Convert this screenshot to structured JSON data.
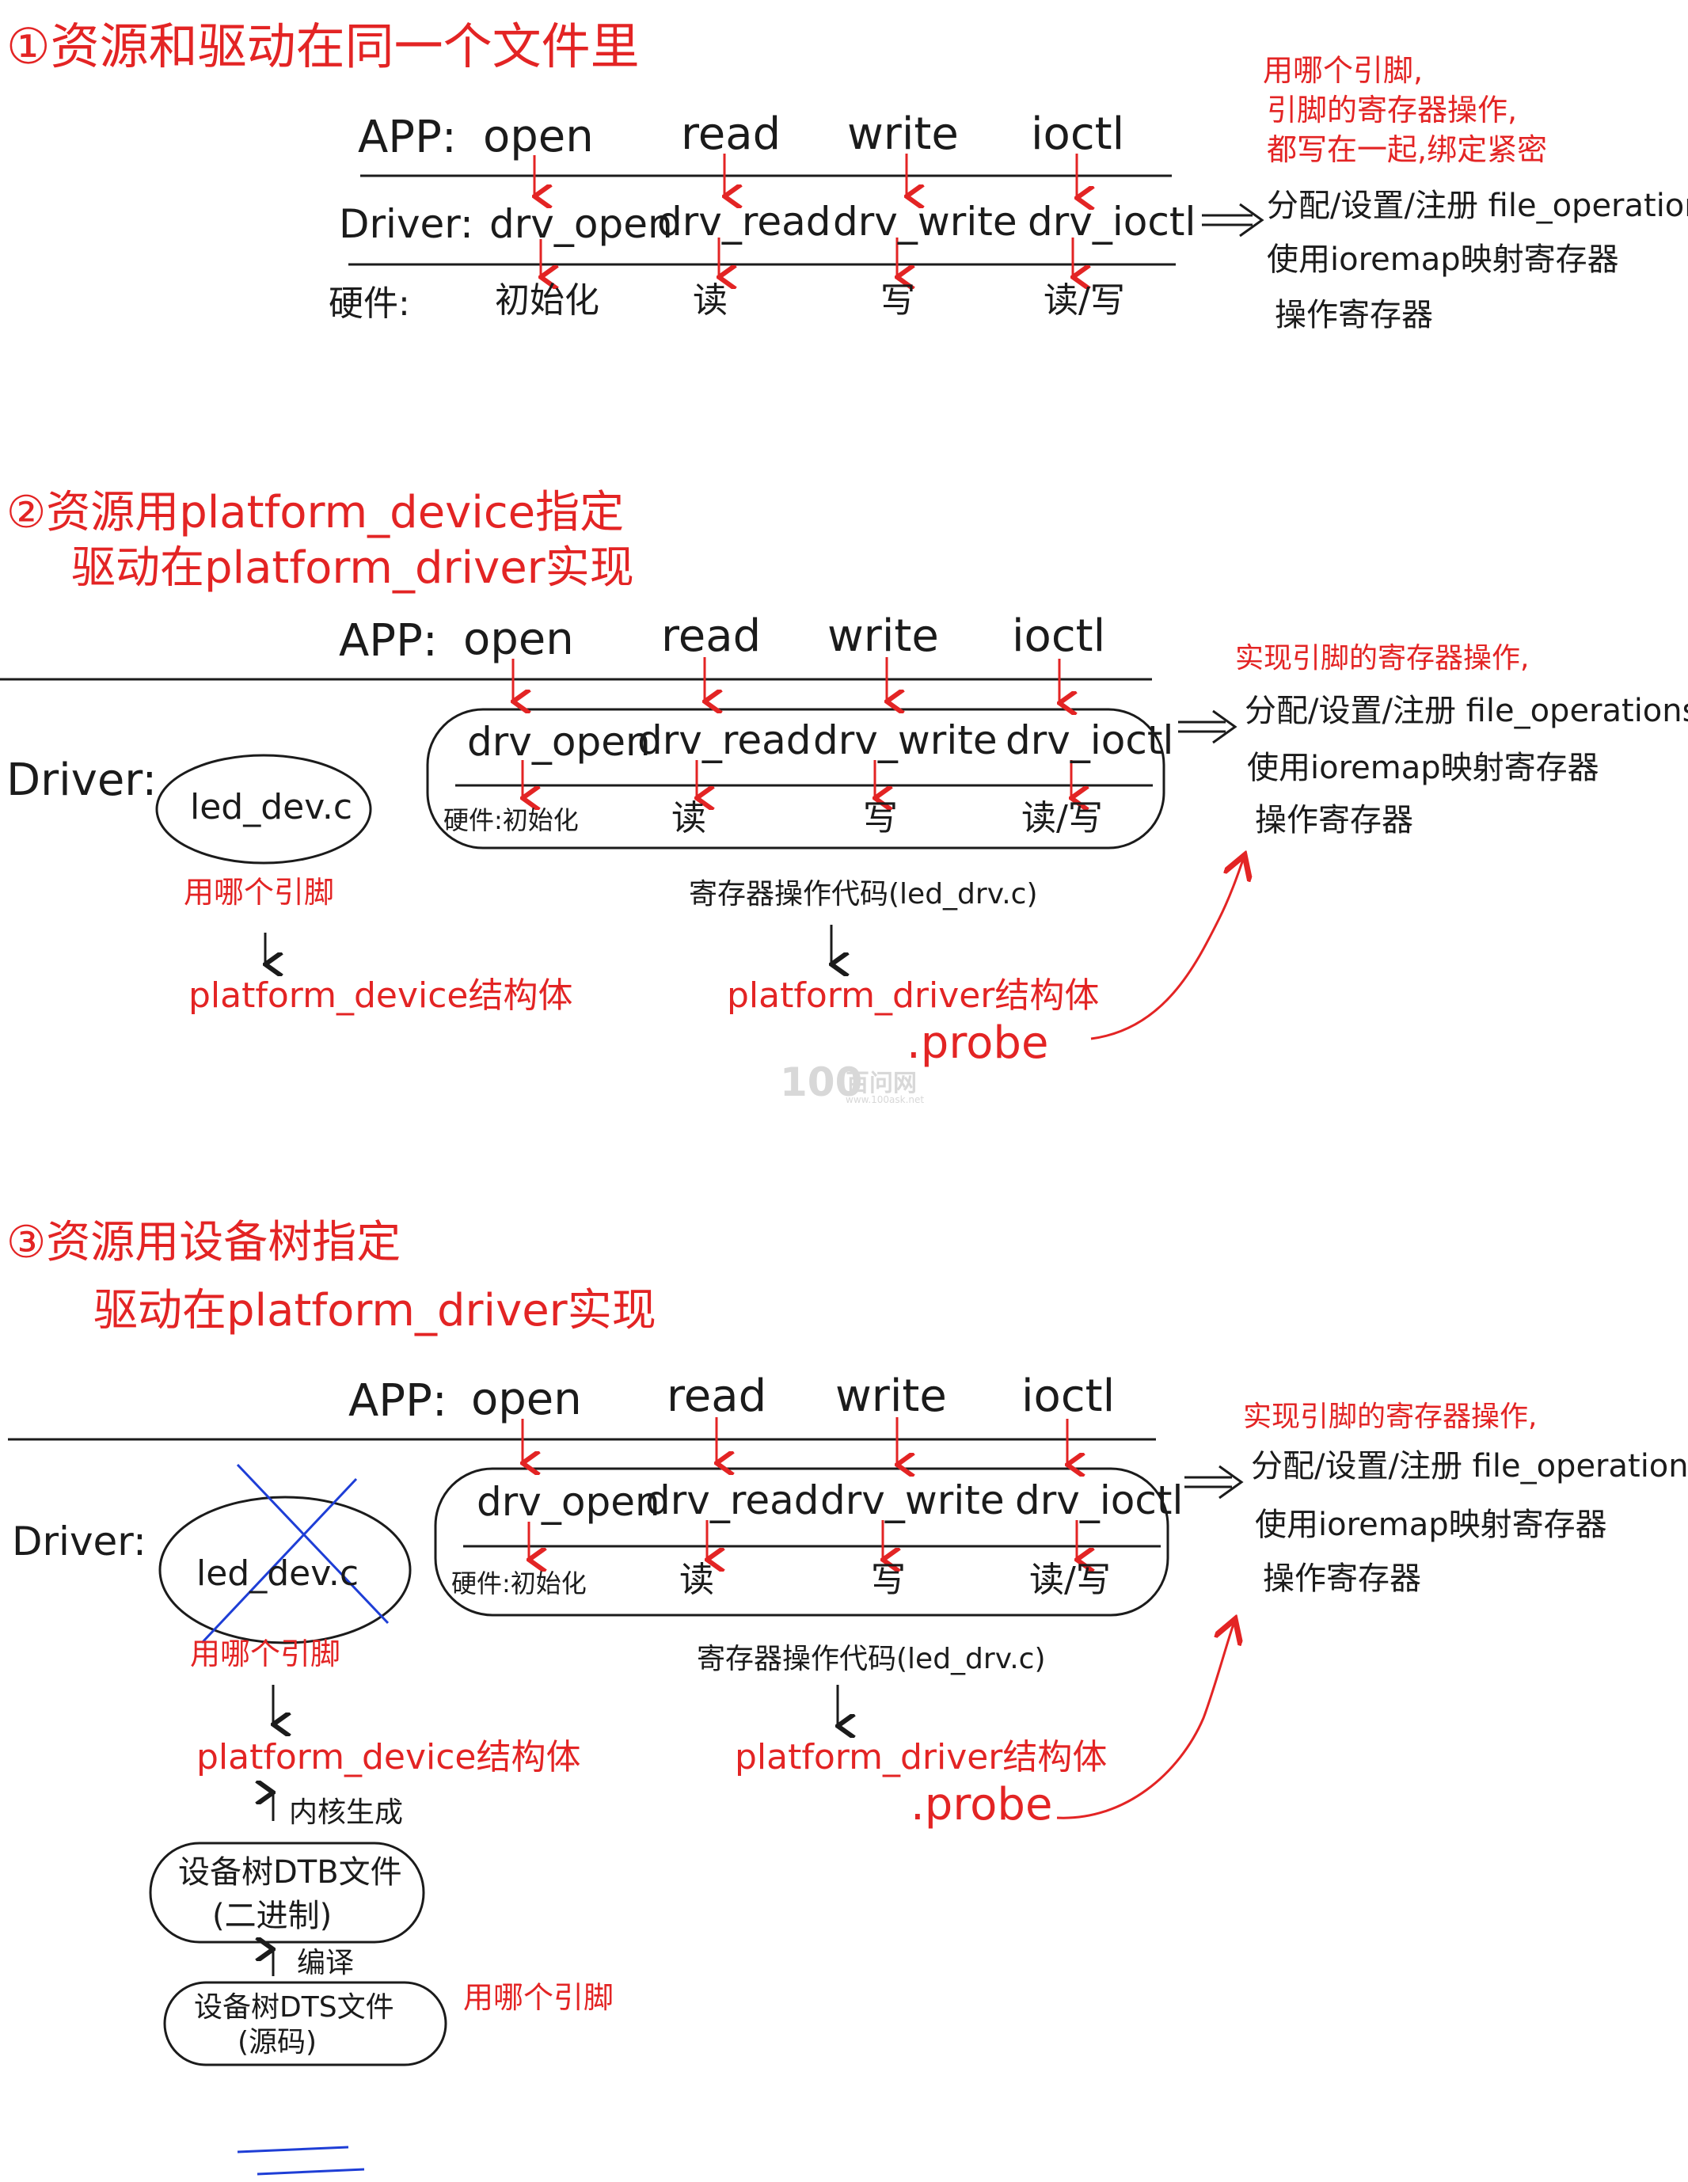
{
  "colors": {
    "ink": "#1b1b1b",
    "red": "#e32424",
    "blue": "#1e3ed6",
    "watermark": "#d8d8d8"
  },
  "s1": {
    "title": "①资源和驱动在同一个文件里",
    "app_label": "APP:",
    "calls": [
      "open",
      "read",
      "write",
      "ioctl"
    ],
    "driver_label": "Driver:",
    "drv_funcs": [
      "drv_open",
      "drv_read",
      "drv_write",
      "drv_ioctl"
    ],
    "hw_label": "硬件:",
    "hw_ops": [
      "初始化",
      "读",
      "写",
      "读/写"
    ],
    "note_lines": [
      "用哪个引脚,",
      "引脚的寄存器操作,",
      "都写在一起,绑定紧密"
    ],
    "ops_lines": [
      "分配/设置/注册 file_operations",
      "使用ioremap映射寄存器",
      "操作寄存器"
    ]
  },
  "s2": {
    "title_1": "②资源用platform_device指定",
    "title_2": "驱动在platform_driver实现",
    "app_label": "APP:",
    "calls": [
      "open",
      "read",
      "write",
      "ioctl"
    ],
    "driver_label": "Driver:",
    "dev_file": "led_dev.c",
    "drv_funcs": [
      "drv_open",
      "drv_read",
      "drv_write",
      "drv_ioctl"
    ],
    "hw_label": "硬件:初始化",
    "hw_ops": [
      "读",
      "写",
      "读/写"
    ],
    "pin_note": "用哪个引脚",
    "dev_struct": "platform_device结构体",
    "reg_code": "寄存器操作代码(led_drv.c)",
    "drv_struct": "platform_driver结构体",
    "probe": ".probe",
    "impl_note": "实现引脚的寄存器操作,",
    "ops_lines": [
      "分配/设置/注册 file_operations",
      "使用ioremap映射寄存器",
      "操作寄存器"
    ]
  },
  "s3": {
    "title_1": "③资源用设备树指定",
    "title_2": "驱动在platform_driver实现",
    "app_label": "APP:",
    "calls": [
      "open",
      "read",
      "write",
      "ioctl"
    ],
    "driver_label": "Driver:",
    "dev_file": "led_dev.c",
    "drv_funcs": [
      "drv_open",
      "drv_read",
      "drv_write",
      "drv_ioctl"
    ],
    "hw_label": "硬件:初始化",
    "hw_ops": [
      "读",
      "写",
      "读/写"
    ],
    "pin_note": "用哪个引脚",
    "dev_struct": "platform_device结构体",
    "kernel_gen": "内核生成",
    "dtb_1": "设备树DTB文件",
    "dtb_2": "(二进制)",
    "compile": "编译",
    "dts_1": "设备树DTS文件",
    "dts_2": "(源码)",
    "dts_note": "用哪个引脚",
    "reg_code": "寄存器操作代码(led_drv.c)",
    "drv_struct": "platform_driver结构体",
    "probe": ".probe",
    "impl_note": "实现引脚的寄存器操作,",
    "ops_lines": [
      "分配/设置/注册 file_operations",
      "使用ioremap映射寄存器",
      "操作寄存器"
    ]
  },
  "watermark": {
    "logo": "100",
    "site": "百问网",
    "url": "www.100ask.net"
  }
}
